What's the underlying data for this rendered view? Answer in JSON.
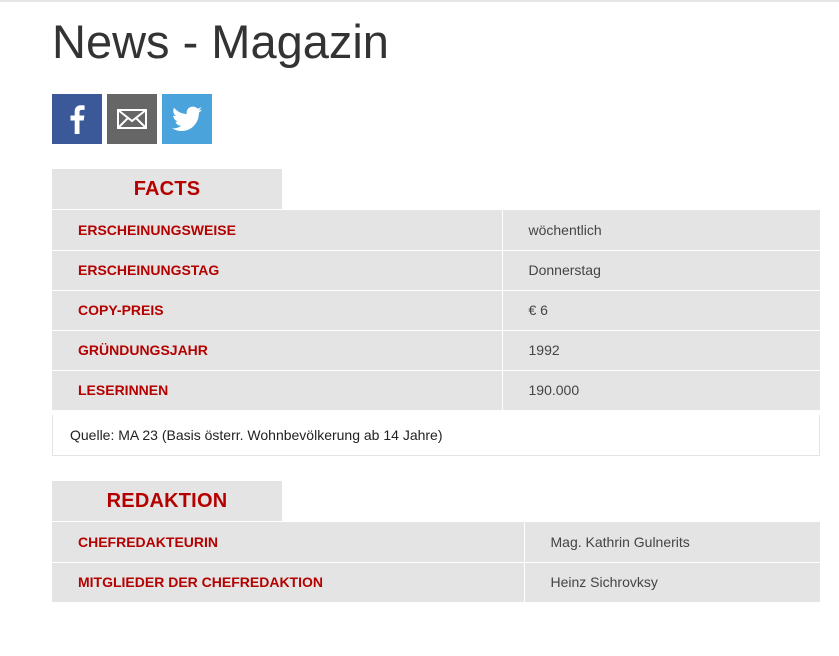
{
  "page": {
    "title": "News - Magazin"
  },
  "share": {
    "facebook_icon": "facebook-icon",
    "mail_icon": "mail-icon",
    "twitter_icon": "twitter-icon"
  },
  "facts": {
    "heading": "FACTS",
    "rows": [
      {
        "label": "ERSCHEINUNGSWEISE",
        "value": "wöchentlich"
      },
      {
        "label": "ERSCHEINUNGSTAG",
        "value": "Donnerstag"
      },
      {
        "label": "COPY-PREIS",
        "value": "€ 6"
      },
      {
        "label": "GRÜNDUNGSJAHR",
        "value": "1992"
      },
      {
        "label": "LESERINNEN",
        "value": "190.000"
      }
    ],
    "source": "Quelle: MA 23 (Basis österr. Wohnbevölkerung ab 14 Jahre)"
  },
  "redaktion": {
    "heading": "REDAKTION",
    "rows": [
      {
        "label": "CHEFREDAKTEURIN",
        "value": "Mag. Kathrin Gulnerits"
      },
      {
        "label": "MITGLIEDER DER CHEFREDAKTION",
        "value": "Heinz Sichrovksy"
      }
    ]
  },
  "colors": {
    "accent": "#b50000",
    "panel": "#e4e4e4",
    "facebook": "#3b5998",
    "mail": "#666666",
    "twitter": "#4ba3dc"
  }
}
